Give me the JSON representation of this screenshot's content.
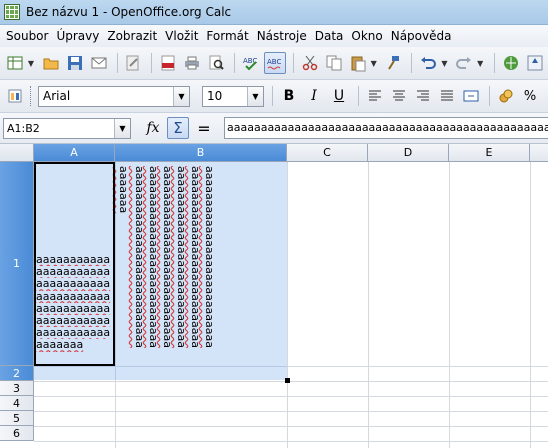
{
  "window": {
    "title": "Bez názvu 1 - OpenOffice.org Calc"
  },
  "menu": [
    {
      "label": "Soubor"
    },
    {
      "label": "Úpravy"
    },
    {
      "label": "Zobrazit"
    },
    {
      "label": "Vložit"
    },
    {
      "label": "Formát"
    },
    {
      "label": "Nástroje"
    },
    {
      "label": "Data"
    },
    {
      "label": "Okno"
    },
    {
      "label": "Nápověda"
    }
  ],
  "toolbar_std": {
    "icons": [
      "new-icon",
      "open-icon",
      "save-icon",
      "email-icon",
      "edit-file-icon",
      "export-pdf-icon",
      "print-icon",
      "page-preview-icon",
      "spellcheck-icon",
      "autospell-icon",
      "cut-icon",
      "copy-icon",
      "paste-icon",
      "format-paintbrush-icon",
      "undo-icon",
      "redo-icon",
      "hyperlink-icon",
      "navigator-icon"
    ]
  },
  "toolbar_fmt": {
    "font_name": "Arial",
    "font_size": "10",
    "bold": "B",
    "italic": "I",
    "underline": "U",
    "currency": "%"
  },
  "formula": {
    "cell_ref": "A1:B2",
    "fx": "fx",
    "sum": "Σ",
    "equals": "=",
    "content": "aaaaaaaaaaaaaaaaaaaaaaaaaaaaaaaaaaaaaaaaaaaaaaaaaaaaaaaaaaaaaaaaa"
  },
  "sheet": {
    "columns": [
      "A",
      "B",
      "C",
      "D",
      "E"
    ],
    "rows": [
      "1",
      "2",
      "3",
      "4",
      "5",
      "6"
    ],
    "a1_lines": [
      "aaaaaaaaaaa",
      "aaaaaaaaaaa",
      "aaaaaaaaaaa",
      "aaaaaaaaaaa",
      "aaaaaaaaaaa",
      "aaaaaaaaaaa",
      "aaaaaaaaaaa",
      "aaaaaaa"
    ],
    "b1_columns": [
      "aaaaaaa",
      "aaaaaaaaaaaaaaaaaaaaaaaaaaa",
      "aaaaaaaaaaaaaaaaaaaaaaaaaaa",
      "aaaaaaaaaaaaaaaaaaaaaaaaaaa",
      "aaaaaaaaaaaaaaaaaaaaaaaaaaa",
      "aaaaaaaaaaaaaaaaaaaaaaaaaaa",
      "aaaaaaaaaaaaaaaaaaaaaaaaaaa"
    ]
  }
}
